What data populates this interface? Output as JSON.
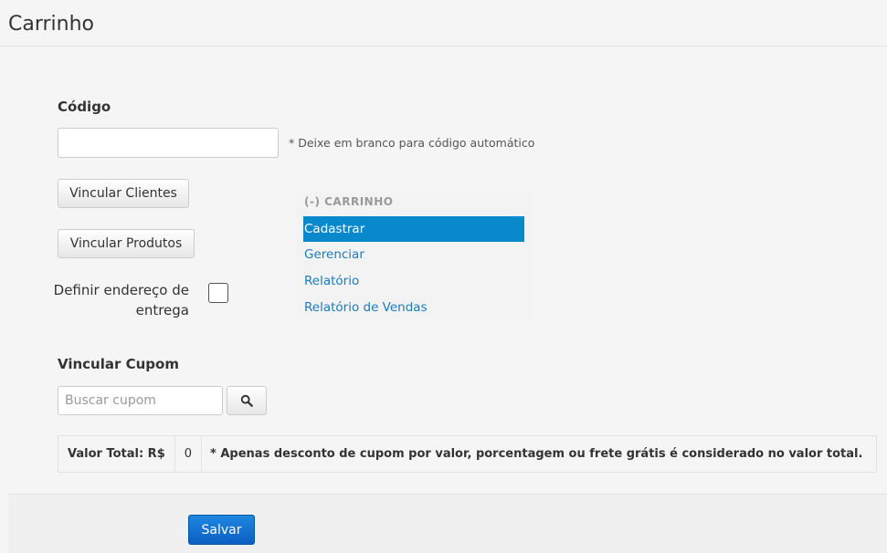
{
  "header": {
    "title": "Carrinho"
  },
  "form": {
    "codigo_label": "Código",
    "codigo_value": "",
    "codigo_hint": "* Deixe em branco para código automático",
    "vincular_clientes_label": "Vincular Clientes",
    "vincular_produtos_label": "Vincular Produtos",
    "endereco_label": "Definir endereço de entrega",
    "endereco_checked": false,
    "cupom_label": "Vincular Cupom",
    "cupom_placeholder": "Buscar cupom",
    "cupom_search_icon": "search-icon"
  },
  "dropdown_menu": {
    "header": "(-) CARRINHO",
    "items": [
      {
        "label": "Cadastrar",
        "active": true
      },
      {
        "label": "Gerenciar",
        "active": false
      },
      {
        "label": "Relatório",
        "active": false
      },
      {
        "label": "Relatório de Vendas",
        "active": false
      }
    ]
  },
  "total": {
    "label": "Valor Total: R$",
    "value": "0",
    "note": "* Apenas desconto de cupom por valor, porcentagem ou frete grátis é considerado no valor total."
  },
  "footer": {
    "save_label": "Salvar"
  },
  "colors": {
    "accent": "#0a88cc",
    "link": "#1a7bbd",
    "primary_button": "#0b5fc2"
  }
}
